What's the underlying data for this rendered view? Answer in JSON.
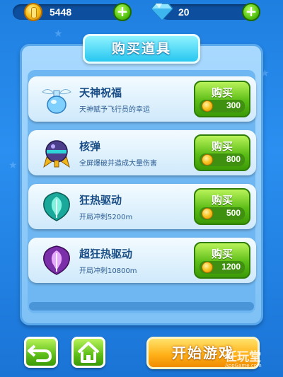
{
  "currency": {
    "coins": "5448",
    "gems": "20"
  },
  "shop": {
    "title": "购买道具",
    "items": [
      {
        "name": "天神祝福",
        "desc": "天神赋予飞行员的幸运",
        "buy": "购买",
        "price": "300",
        "icon": "winged-potion-icon"
      },
      {
        "name": "核弹",
        "desc": "全屏爆破并造成大量伤害",
        "buy": "购买",
        "price": "800",
        "icon": "nuke-bomb-icon"
      },
      {
        "name": "狂热驱动",
        "desc": "开局冲刺5200m",
        "buy": "购买",
        "price": "500",
        "icon": "teal-boost-icon"
      },
      {
        "name": "超狂热驱动",
        "desc": "开局冲刺10800m",
        "buy": "购买",
        "price": "1200",
        "icon": "purple-boost-icon"
      }
    ]
  },
  "footer": {
    "start": "开始游戏",
    "watermark": "任玩堂",
    "watermark_site": "AppGame.com"
  },
  "colors": {
    "accent_green": "#5cbd17",
    "start_orange": "#ffb21a",
    "panel_blue": "#7fc1f5"
  }
}
